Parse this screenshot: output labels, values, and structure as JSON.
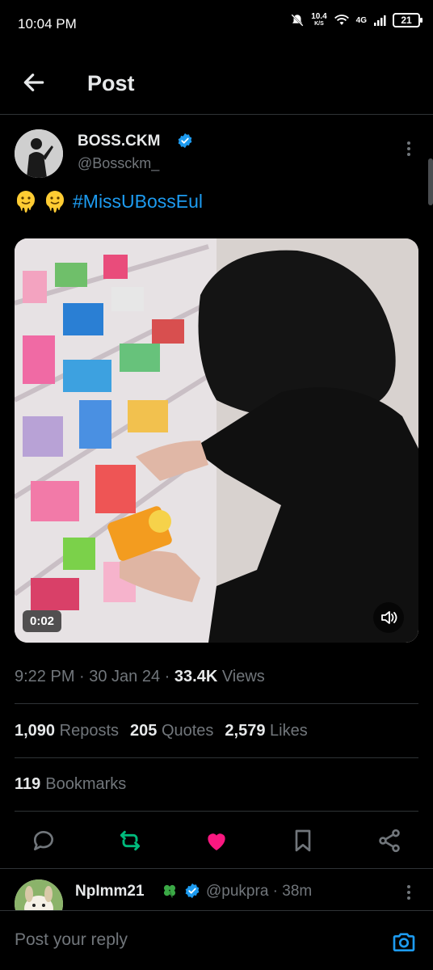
{
  "status_bar": {
    "time": "10:04 PM",
    "net_speed_value": "10.4",
    "net_speed_unit": "K/S",
    "network": "4G",
    "battery": "21",
    "icons": [
      "mute-icon",
      "wifi-icon",
      "signal-icon",
      "battery-icon"
    ]
  },
  "header": {
    "title": "Post",
    "back_icon": "arrow-left-icon"
  },
  "post": {
    "author_name": "BOSS.CKM",
    "author_handle": "@Bossckm_",
    "emojis": [
      "melting-face",
      "melting-face"
    ],
    "hashtag": "#MissUBossEul",
    "video_duration": "0:02",
    "timestamp": "9:22 PM · 30 Jan 24 · ",
    "views_count": "33.4K",
    "views_label": " Views"
  },
  "stats": {
    "reposts_count": "1,090",
    "reposts_label": "Reposts",
    "quotes_count": "205",
    "quotes_label": "Quotes",
    "likes_count": "2,579",
    "likes_label": "Likes",
    "bookmarks_count": "119",
    "bookmarks_label": "Bookmarks"
  },
  "actions": [
    "reply-icon",
    "repost-icon",
    "like-icon",
    "bookmark-icon",
    "share-icon"
  ],
  "colors": {
    "background": "#000000",
    "text": "#e7e9ea",
    "secondary": "#71767b",
    "accent": "#1d9bf0",
    "repost_active": "#00ba7c",
    "like_active": "#f91880",
    "divider": "#2f3336"
  },
  "reply": {
    "author_name": "NpImm21",
    "author_handle": "@pukpra · 38m"
  },
  "composer": {
    "placeholder": "Post your reply"
  }
}
